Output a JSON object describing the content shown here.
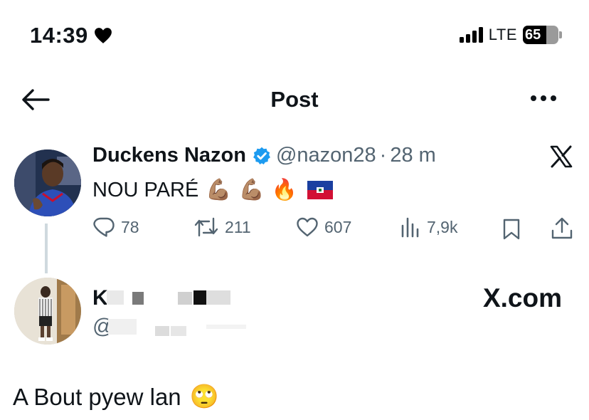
{
  "status_bar": {
    "time": "14:39",
    "network": "LTE",
    "battery": "65",
    "battery_level": 0.65,
    "icons": [
      "heart-icon",
      "signal-icon",
      "battery-icon"
    ]
  },
  "header": {
    "title": "Post",
    "icons": [
      "back-arrow-icon",
      "more-options-icon"
    ]
  },
  "main_post": {
    "author_name": "Duckens Nazon",
    "handle": "@nazon28",
    "separator": "·",
    "time_ago": "28 m",
    "text": "NOU PARÉ",
    "text_emojis": [
      "💪🏽",
      "💪🏽",
      "🔥"
    ],
    "flag_icon": "haiti-flag-icon",
    "verified_icon": "verified-badge-icon",
    "platform_icon": "x-logo-icon",
    "stats": {
      "replies": "78",
      "reposts": "211",
      "likes": "607",
      "views": "7,9k"
    }
  },
  "reply_post": {
    "author_name_visible": "K",
    "handle_visible": "@",
    "watermark": "X.com",
    "text": "A Bout pyew lan",
    "emoji": "🙄"
  },
  "colors": {
    "text": "#0f1419",
    "secondary": "#536471",
    "verified": "#1d9bf0",
    "thread_line": "#cfd9de"
  }
}
